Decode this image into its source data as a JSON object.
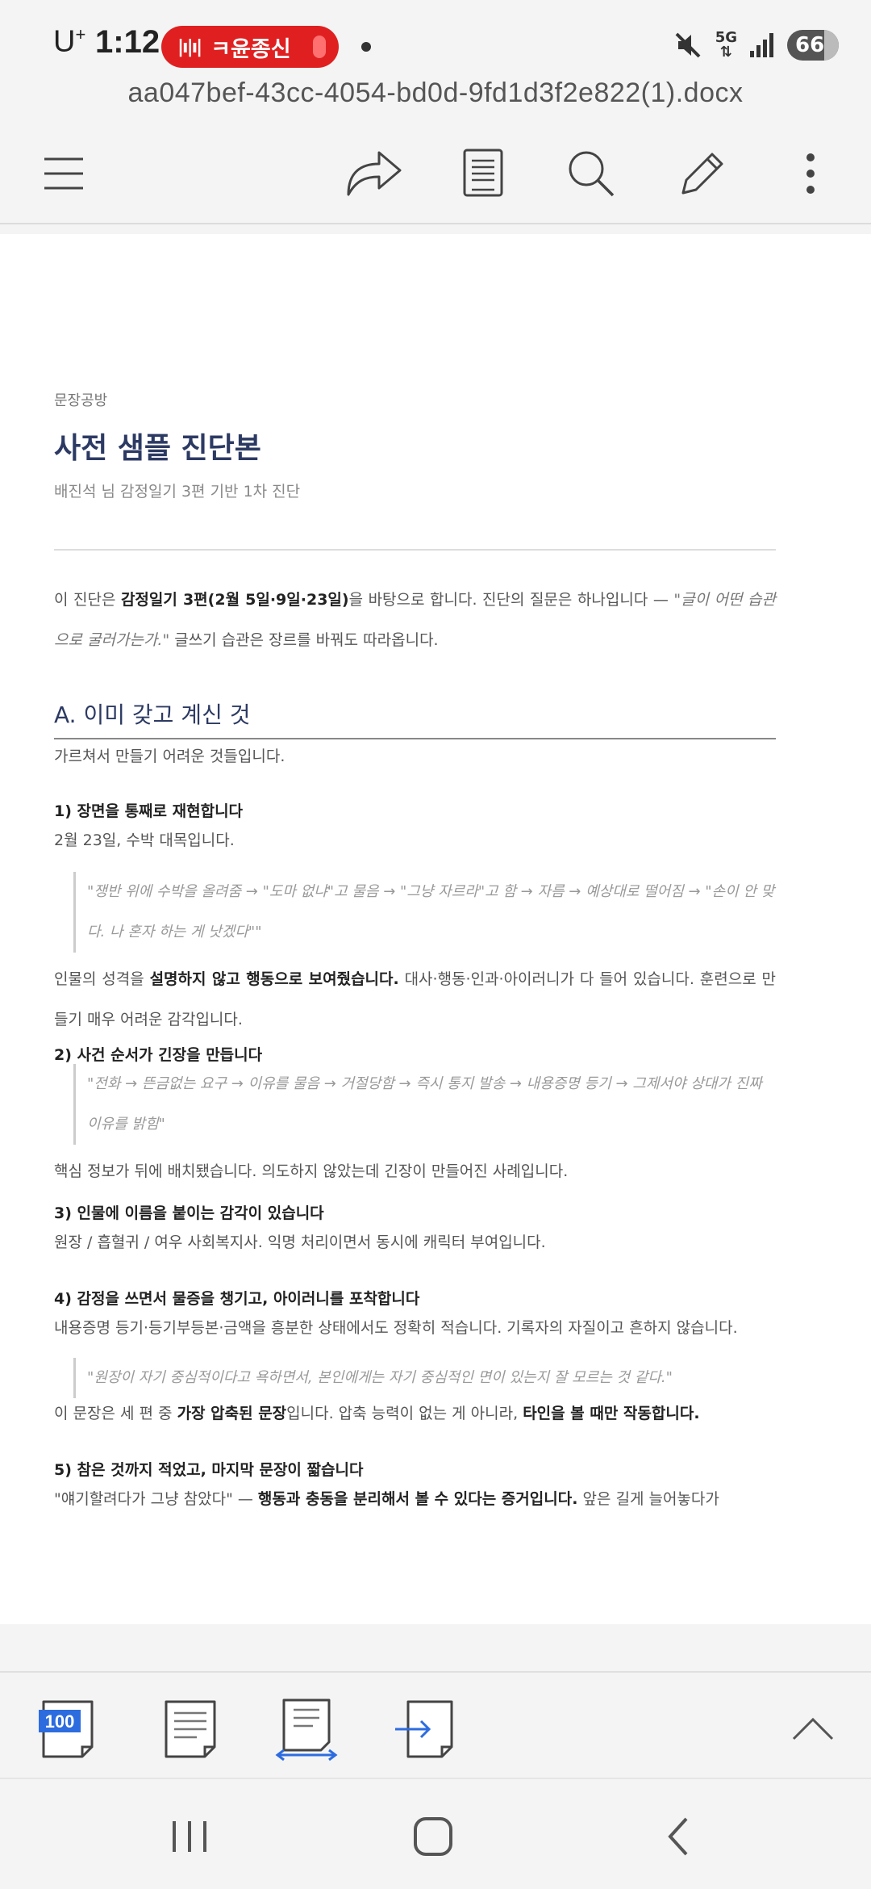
{
  "status": {
    "carrier": "U",
    "carrier_sup": "+",
    "time": "1:12",
    "pill_label": "ㅋ윤종신",
    "network": "5G",
    "battery": "66"
  },
  "file": {
    "name": "aa047bef-43cc-4054-bd0d-9fd1d3f2e822(1).docx"
  },
  "toolbar": {
    "icons": [
      "menu-icon",
      "share-icon",
      "reader-mode-icon",
      "search-icon",
      "edit-icon",
      "more-icon"
    ]
  },
  "doc": {
    "brand": "문장공방",
    "title": "사전 샘플 진단본",
    "subtitle": "배진석 님 감정일기 3편 기반 1차 진단",
    "intro": {
      "pre": "이 진단은 ",
      "bold": "감정일기 3편(2월 5일·9일·23일)",
      "mid": "을 바탕으로 합니다. 진단의 질문은 하나입니다 — ",
      "italic": "\"글이 어떤 습관으로 굴러가는가.\"",
      "post": " 글쓰기 습관은 장르를 바꿔도 따라옵니다."
    },
    "section_a": {
      "heading": "A.  이미 갖고 계신 것",
      "lead": "가르쳐서 만들기 어려운 것들입니다."
    },
    "item1": {
      "heading": "1)  장면을 통째로 재현합니다",
      "line": "2월 23일, 수박 대목입니다.",
      "quote": "\"쟁반 위에 수박을 올려줌 → \"도마 없냐\"고 물음 → \"그냥 자르라\"고 함 → 자름 → 예상대로 떨어짐 → \"손이 안 맞다. 나 혼자 하는 게 낫겠다\"\"",
      "body_pre": "인물의 성격을 ",
      "body_bold": "설명하지 않고 행동으로 보여줬습니다.",
      "body_post": " 대사·행동·인과·아이러니가 다 들어 있습니다. 훈련으로 만들기 매우 어려운 감각입니다."
    },
    "item2": {
      "heading": "2)  사건 순서가 긴장을 만듭니다",
      "quote": "\"전화 → 뜬금없는 요구 → 이유를 물음 → 거절당함 → 즉시 통지 발송 → 내용증명 등기 → 그제서야 상대가 진짜 이유를 밝힘\"",
      "body": "핵심 정보가 뒤에 배치됐습니다. 의도하지 않았는데 긴장이 만들어진 사례입니다."
    },
    "item3": {
      "heading": "3)  인물에 이름을 붙이는 감각이 있습니다",
      "body": "원장 / 흡혈귀 / 여우 사회복지사. 익명 처리이면서 동시에 캐릭터 부여입니다."
    },
    "item4": {
      "heading": "4)  감정을 쓰면서 물증을 챙기고, 아이러니를 포착합니다",
      "body": "내용증명 등기·등기부등본·금액을 흥분한 상태에서도 정확히 적습니다. 기록자의 자질이고 흔하지 않습니다.",
      "quote": "\"원장이 자기 중심적이다고 욕하면서, 본인에게는 자기 중심적인 면이 있는지 잘 모르는 것 같다.\"",
      "body2_pre": "이 문장은 세 편 중 ",
      "body2_bold": "가장 압축된 문장",
      "body2_mid": "입니다. 압축 능력이 없는 게 아니라, ",
      "body2_bold2": "타인을 볼 때만 작동합니다."
    },
    "item5": {
      "heading": "5)  참은 것까지 적었고, 마지막 문장이 짧습니다",
      "body_pre": "\"얘기할려다가 그냥 참았다\" — ",
      "body_bold": "행동과 충동을 분리해서 볼 수 있다는 증거입니다.",
      "body_post": " 앞은 길게 늘어놓다가"
    }
  },
  "bottombar": {
    "zoom_badge": "100",
    "icons": [
      "fit-page-icon",
      "page-view-icon",
      "page-width-icon",
      "goto-page-icon",
      "collapse-up-icon"
    ]
  },
  "navbar": {
    "icons": [
      "recents-icon",
      "home-icon",
      "back-icon"
    ]
  }
}
